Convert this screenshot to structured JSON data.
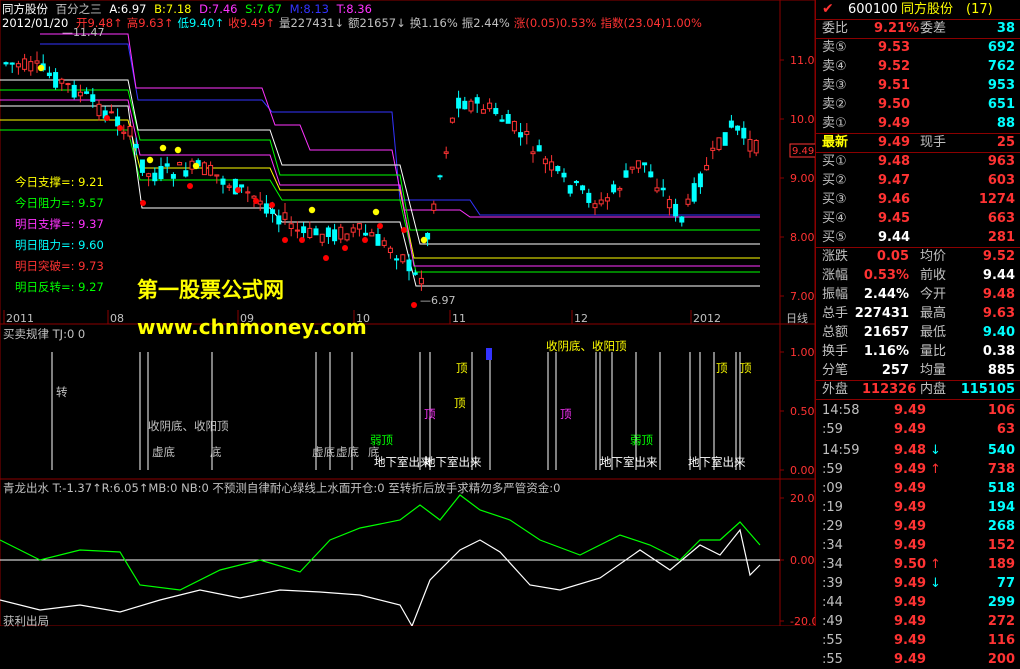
{
  "header": {
    "stock_name": "同方股份",
    "indicator_name": "百分之三",
    "date": "2012/01/20",
    "fields": [
      {
        "text": "开9.48↑",
        "color": "#ff3333"
      },
      {
        "text": "高9.63↑",
        "color": "#ff3333"
      },
      {
        "text": "低9.40↑",
        "color": "#00ffff"
      },
      {
        "text": "收9.49↑",
        "color": "#ff3333"
      },
      {
        "text": "量227431↓",
        "color": "#c0c0c0"
      },
      {
        "text": "额21657↓",
        "color": "#c0c0c0"
      },
      {
        "text": "换1.16%",
        "color": "#c0c0c0"
      },
      {
        "text": "振2.44%",
        "color": "#c0c0c0"
      },
      {
        "text": "涨(0.05)0.53%",
        "color": "#ff3333"
      },
      {
        "text": "指数(23.04)1.00%",
        "color": "#ff3333"
      }
    ],
    "ma_labels": [
      {
        "text": "A:6.97",
        "color": "#ffffff"
      },
      {
        "text": "B:7.18",
        "color": "#ffff00"
      },
      {
        "text": "D:7.46",
        "color": "#ff33ff"
      },
      {
        "text": "S:7.67",
        "color": "#00ff00"
      },
      {
        "text": "M:8.13",
        "color": "#3333ff"
      },
      {
        "text": "T:8.36",
        "color": "#ff33ff"
      }
    ]
  },
  "main_chart": {
    "high_marker": "11.47",
    "low_marker": "6.97",
    "price_badge": "9.49",
    "y_ticks": [
      "11.00",
      "10.00",
      "9.00",
      "8.00",
      "7.00"
    ],
    "x_ticks": [
      "2011",
      "08",
      "09",
      "10",
      "11",
      "12",
      "2012"
    ],
    "period": "日线",
    "levels": [
      {
        "label": "今日支撑=: 9.21",
        "color": "#ffff00"
      },
      {
        "label": "今日阻力=: 9.57",
        "color": "#00ff00"
      },
      {
        "label": "明日支撑=: 9.37",
        "color": "#ff33ff"
      },
      {
        "label": "明日阻力=: 9.60",
        "color": "#00ffff"
      },
      {
        "label": "明日突破=: 9.73",
        "color": "#ff3333"
      },
      {
        "label": "明日反转=: 9.27",
        "color": "#00ff00"
      }
    ],
    "watermark_cn": "第一股票公式网",
    "watermark_url": "www.chnmoney.com"
  },
  "panel2": {
    "title": "买卖规律 TJ:0 0",
    "y_ticks": [
      "1.00",
      "0.50",
      "0.00"
    ],
    "labels": [
      {
        "text": "转",
        "color": "#c0c0c0"
      },
      {
        "text": "收阴底、收阳顶",
        "color": "#c0c0c0"
      },
      {
        "text": "虚底",
        "color": "#c0c0c0"
      },
      {
        "text": "底",
        "color": "#c0c0c0"
      },
      {
        "text": "虚底",
        "color": "#c0c0c0"
      },
      {
        "text": "虚底",
        "color": "#c0c0c0"
      },
      {
        "text": "底",
        "color": "#c0c0c0"
      },
      {
        "text": "弱顶",
        "color": "#00ff00"
      },
      {
        "text": "地下室出来",
        "color": "#ffffff"
      },
      {
        "text": "地下室出来",
        "color": "#ffffff"
      },
      {
        "text": "顶",
        "color": "#ffff00"
      },
      {
        "text": "顶",
        "color": "#ff33ff"
      },
      {
        "text": "收阴底、收阳顶",
        "color": "#ffff00"
      },
      {
        "text": "顶",
        "color": "#ffff00"
      },
      {
        "text": "顶",
        "color": "#ff33ff"
      },
      {
        "text": "弱顶",
        "color": "#00ff00"
      },
      {
        "text": "地下室出来",
        "color": "#ffffff"
      },
      {
        "text": "地下室出来",
        "color": "#ffffff"
      },
      {
        "text": "顶",
        "color": "#ffff00"
      },
      {
        "text": "顶",
        "color": "#ffff00"
      }
    ]
  },
  "panel3": {
    "title": "青龙出水 T:-1.37↑R:6.05↑MB:0 NB:0 不预测自律耐心绿线上水面开仓:0 至转折后放手求精勿多严管资金:0",
    "y_ticks": [
      "20.00",
      "0.00",
      "-20.00"
    ],
    "bottom_label": "获利出局"
  },
  "quote": {
    "code": "600100",
    "name": "同方股份",
    "count": "(17)",
    "weibi_label": "委比",
    "weibi_value": "9.21%",
    "weicha_label": "委差",
    "weicha_value": "38",
    "sells": [
      {
        "label": "卖⑤",
        "price": "9.53",
        "vol": "692"
      },
      {
        "label": "卖④",
        "price": "9.52",
        "vol": "762"
      },
      {
        "label": "卖③",
        "price": "9.51",
        "vol": "953"
      },
      {
        "label": "卖②",
        "price": "9.50",
        "vol": "651"
      },
      {
        "label": "卖①",
        "price": "9.49",
        "vol": "88"
      }
    ],
    "last_label": "最新",
    "last_price": "9.49",
    "hand_label": "现手",
    "hand_value": "25",
    "buys": [
      {
        "label": "买①",
        "price": "9.48",
        "vol": "963"
      },
      {
        "label": "买②",
        "price": "9.47",
        "vol": "603"
      },
      {
        "label": "买③",
        "price": "9.46",
        "vol": "1274"
      },
      {
        "label": "买④",
        "price": "9.45",
        "vol": "663"
      },
      {
        "label": "买⑤",
        "price": "9.44",
        "vol": "281"
      }
    ],
    "stats": [
      {
        "l1": "涨跌",
        "v1": "0.05",
        "c1": "#ff3333",
        "l2": "均价",
        "v2": "9.52",
        "c2": "#ff3333"
      },
      {
        "l1": "涨幅",
        "v1": "0.53%",
        "c1": "#ff3333",
        "l2": "前收",
        "v2": "9.44",
        "c2": "#ffffff"
      },
      {
        "l1": "振幅",
        "v1": "2.44%",
        "c1": "#ffffff",
        "l2": "今开",
        "v2": "9.48",
        "c2": "#ff3333"
      },
      {
        "l1": "总手",
        "v1": "227431",
        "c1": "#ffffff",
        "l2": "最高",
        "v2": "9.63",
        "c2": "#ff3333"
      },
      {
        "l1": "总额",
        "v1": "21657",
        "c1": "#ffffff",
        "l2": "最低",
        "v2": "9.40",
        "c2": "#00ffff"
      },
      {
        "l1": "换手",
        "v1": "1.16%",
        "c1": "#ffffff",
        "l2": "量比",
        "v2": "0.38",
        "c2": "#ffffff"
      },
      {
        "l1": "分笔",
        "v1": "257",
        "c1": "#ffffff",
        "l2": "均量",
        "v2": "885",
        "c2": "#ffffff"
      }
    ],
    "outer_label": "外盘",
    "outer_value": "112326",
    "inner_label": "内盘",
    "inner_value": "115105",
    "ticks": [
      {
        "time": "14:58",
        "price": "9.49",
        "arrow": "",
        "vol": "106",
        "vc": "#ff3333"
      },
      {
        "time": ":59",
        "price": "9.49",
        "arrow": "",
        "vol": "63",
        "vc": "#ff3333"
      },
      {
        "time": "14:59",
        "price": "9.48",
        "arrow": "↓",
        "vol": "540",
        "vc": "#00ffff"
      },
      {
        "time": ":59",
        "price": "9.49",
        "arrow": "↑",
        "vol": "738",
        "vc": "#ff3333"
      },
      {
        "time": ":09",
        "price": "9.49",
        "arrow": "",
        "vol": "518",
        "vc": "#00ffff"
      },
      {
        "time": ":19",
        "price": "9.49",
        "arrow": "",
        "vol": "194",
        "vc": "#00ffff"
      },
      {
        "time": ":29",
        "price": "9.49",
        "arrow": "",
        "vol": "268",
        "vc": "#00ffff"
      },
      {
        "time": ":34",
        "price": "9.49",
        "arrow": "",
        "vol": "152",
        "vc": "#ff3333"
      },
      {
        "time": ":34",
        "price": "9.50",
        "arrow": "↑",
        "vol": "189",
        "vc": "#ff3333"
      },
      {
        "time": ":39",
        "price": "9.49",
        "arrow": "↓",
        "vol": "77",
        "vc": "#00ffff"
      },
      {
        "time": ":44",
        "price": "9.49",
        "arrow": "",
        "vol": "299",
        "vc": "#00ffff"
      },
      {
        "time": ":49",
        "price": "9.49",
        "arrow": "",
        "vol": "272",
        "vc": "#ff3333"
      },
      {
        "time": ":55",
        "price": "9.49",
        "arrow": "",
        "vol": "116",
        "vc": "#ff3333"
      },
      {
        "time": ":55",
        "price": "9.49",
        "arrow": "",
        "vol": "200",
        "vc": "#ff3333"
      }
    ]
  }
}
